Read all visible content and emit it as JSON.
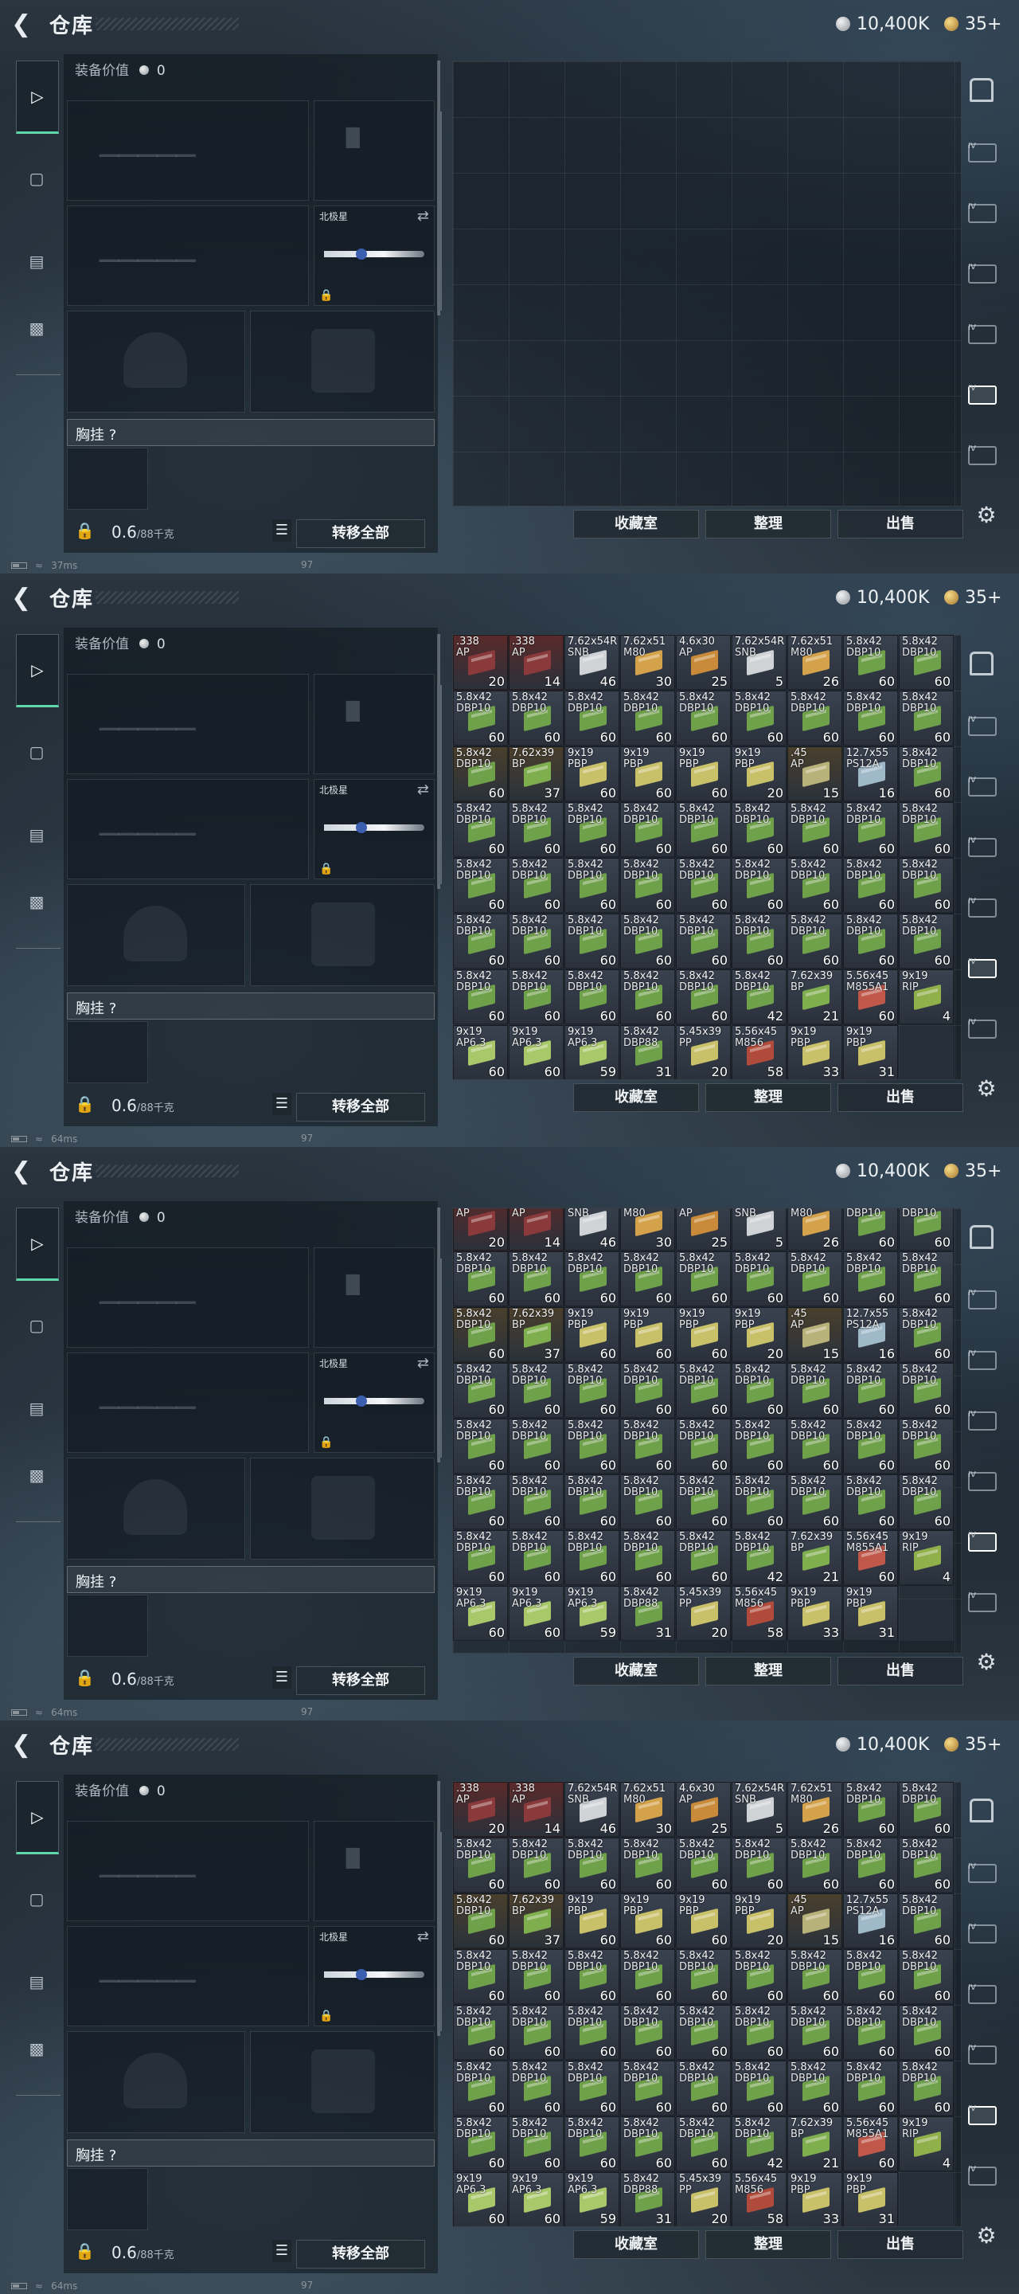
{
  "screens": [
    {
      "title": "仓库",
      "currency": {
        "silver": "10,400K",
        "gold": "35+"
      },
      "equip_value_label": "装备价值",
      "equip_value": "0",
      "knife_label": "北极星",
      "rig_label": "胸挂 ?",
      "weight": "0.6",
      "weight_max": "/88千克",
      "transfer_all": "转移全部",
      "buttons": {
        "collect": "收藏室",
        "sort": "整理",
        "sell": "出售"
      },
      "status": {
        "ping": "37ms",
        "fps": "97"
      },
      "grid_offset": 0,
      "has_items": false
    },
    {
      "title": "仓库",
      "currency": {
        "silver": "10,400K",
        "gold": "35+"
      },
      "equip_value_label": "装备价值",
      "equip_value": "0",
      "knife_label": "北极星",
      "rig_label": "胸挂 ?",
      "weight": "0.6",
      "weight_max": "/88千克",
      "transfer_all": "转移全部",
      "buttons": {
        "collect": "收藏室",
        "sort": "整理",
        "sell": "出售"
      },
      "status": {
        "ping": "64ms",
        "fps": "97"
      },
      "grid_offset": 0,
      "has_items": true
    },
    {
      "title": "仓库",
      "currency": {
        "silver": "10,400K",
        "gold": "35+"
      },
      "equip_value_label": "装备价值",
      "equip_value": "0",
      "knife_label": "北极星",
      "rig_label": "胸挂 ?",
      "weight": "0.6",
      "weight_max": "/88千克",
      "transfer_all": "转移全部",
      "buttons": {
        "collect": "收藏室",
        "sort": "整理",
        "sell": "出售"
      },
      "status": {
        "ping": "64ms",
        "fps": "97"
      },
      "grid_offset": 1,
      "has_items": true
    },
    {
      "title": "仓库",
      "currency": {
        "silver": "10,400K",
        "gold": "35+"
      },
      "equip_value_label": "装备价值",
      "equip_value": "0",
      "knife_label": "北极星",
      "rig_label": "胸挂 ?",
      "weight": "0.6",
      "weight_max": "/88千克",
      "transfer_all": "转移全部",
      "buttons": {
        "collect": "收藏室",
        "sort": "整理",
        "sell": "出售"
      },
      "status": {
        "ping": "64ms",
        "fps": "97"
      },
      "grid_offset": 0,
      "has_items": true
    }
  ],
  "stash_rows": [
    [
      {
        "n": ".338",
        "s": "AP",
        "q": "20",
        "c": "#8a3a3a"
      },
      {
        "n": ".338",
        "s": "AP",
        "q": "14",
        "c": "#8a3a3a"
      },
      {
        "n": "7.62x54R",
        "s": "SNB",
        "q": "46",
        "c": "#cfd3d6"
      },
      {
        "n": "7.62x51",
        "s": "M80",
        "q": "30",
        "c": "#d4a24a"
      },
      {
        "n": "4.6x30",
        "s": "AP",
        "q": "25",
        "c": "#c98a3a"
      },
      {
        "n": "7.62x54R",
        "s": "SNB",
        "q": "5",
        "c": "#cfd3d6"
      },
      {
        "n": "7.62x51",
        "s": "M80",
        "q": "26",
        "c": "#d4a24a"
      },
      {
        "n": "5.8x42",
        "s": "DBP10",
        "q": "60",
        "c": "#6fa04a"
      },
      {
        "n": "5.8x42",
        "s": "DBP10",
        "q": "60",
        "c": "#6fa04a"
      }
    ],
    [
      {
        "n": "5.8x42",
        "s": "DBP10",
        "q": "60",
        "c": "#6fa04a"
      },
      {
        "n": "5.8x42",
        "s": "DBP10",
        "q": "60",
        "c": "#6fa04a"
      },
      {
        "n": "5.8x42",
        "s": "DBP10",
        "q": "60",
        "c": "#6fa04a"
      },
      {
        "n": "5.8x42",
        "s": "DBP10",
        "q": "60",
        "c": "#6fa04a"
      },
      {
        "n": "5.8x42",
        "s": "DBP10",
        "q": "60",
        "c": "#6fa04a"
      },
      {
        "n": "5.8x42",
        "s": "DBP10",
        "q": "60",
        "c": "#6fa04a"
      },
      {
        "n": "5.8x42",
        "s": "DBP10",
        "q": "60",
        "c": "#6fa04a"
      },
      {
        "n": "5.8x42",
        "s": "DBP10",
        "q": "60",
        "c": "#6fa04a"
      },
      {
        "n": "5.8x42",
        "s": "DBP10",
        "q": "60",
        "c": "#6fa04a"
      }
    ],
    [
      {
        "n": "5.8x42",
        "s": "DBP10",
        "q": "60",
        "c": "#6fa04a"
      },
      {
        "n": "7.62x39",
        "s": "BP",
        "q": "37",
        "c": "#7fae4e"
      },
      {
        "n": "9x19",
        "s": "PBP",
        "q": "60",
        "c": "#c9c06a"
      },
      {
        "n": "9x19",
        "s": "PBP",
        "q": "60",
        "c": "#c9c06a"
      },
      {
        "n": "9x19",
        "s": "PBP",
        "q": "60",
        "c": "#c9c06a"
      },
      {
        "n": "9x19",
        "s": "PBP",
        "q": "20",
        "c": "#c9c06a"
      },
      {
        "n": ".45",
        "s": "AP",
        "q": "15",
        "c": "#b7b27a"
      },
      {
        "n": "12.7x55",
        "s": "PS12A",
        "q": "16",
        "c": "#9fb9c9"
      },
      {
        "n": "5.8x42",
        "s": "DBP10",
        "q": "60",
        "c": "#6fa04a"
      }
    ],
    [
      {
        "n": "5.8x42",
        "s": "DBP10",
        "q": "60",
        "c": "#6fa04a"
      },
      {
        "n": "5.8x42",
        "s": "DBP10",
        "q": "60",
        "c": "#6fa04a"
      },
      {
        "n": "5.8x42",
        "s": "DBP10",
        "q": "60",
        "c": "#6fa04a"
      },
      {
        "n": "5.8x42",
        "s": "DBP10",
        "q": "60",
        "c": "#6fa04a"
      },
      {
        "n": "5.8x42",
        "s": "DBP10",
        "q": "60",
        "c": "#6fa04a"
      },
      {
        "n": "5.8x42",
        "s": "DBP10",
        "q": "60",
        "c": "#6fa04a"
      },
      {
        "n": "5.8x42",
        "s": "DBP10",
        "q": "60",
        "c": "#6fa04a"
      },
      {
        "n": "5.8x42",
        "s": "DBP10",
        "q": "60",
        "c": "#6fa04a"
      },
      {
        "n": "5.8x42",
        "s": "DBP10",
        "q": "60",
        "c": "#6fa04a"
      }
    ],
    [
      {
        "n": "5.8x42",
        "s": "DBP10",
        "q": "60",
        "c": "#6fa04a"
      },
      {
        "n": "5.8x42",
        "s": "DBP10",
        "q": "60",
        "c": "#6fa04a"
      },
      {
        "n": "5.8x42",
        "s": "DBP10",
        "q": "60",
        "c": "#6fa04a"
      },
      {
        "n": "5.8x42",
        "s": "DBP10",
        "q": "60",
        "c": "#6fa04a"
      },
      {
        "n": "5.8x42",
        "s": "DBP10",
        "q": "60",
        "c": "#6fa04a"
      },
      {
        "n": "5.8x42",
        "s": "DBP10",
        "q": "60",
        "c": "#6fa04a"
      },
      {
        "n": "5.8x42",
        "s": "DBP10",
        "q": "60",
        "c": "#6fa04a"
      },
      {
        "n": "5.8x42",
        "s": "DBP10",
        "q": "60",
        "c": "#6fa04a"
      },
      {
        "n": "5.8x42",
        "s": "DBP10",
        "q": "60",
        "c": "#6fa04a"
      }
    ],
    [
      {
        "n": "5.8x42",
        "s": "DBP10",
        "q": "60",
        "c": "#6fa04a"
      },
      {
        "n": "5.8x42",
        "s": "DBP10",
        "q": "60",
        "c": "#6fa04a"
      },
      {
        "n": "5.8x42",
        "s": "DBP10",
        "q": "60",
        "c": "#6fa04a"
      },
      {
        "n": "5.8x42",
        "s": "DBP10",
        "q": "60",
        "c": "#6fa04a"
      },
      {
        "n": "5.8x42",
        "s": "DBP10",
        "q": "60",
        "c": "#6fa04a"
      },
      {
        "n": "5.8x42",
        "s": "DBP10",
        "q": "60",
        "c": "#6fa04a"
      },
      {
        "n": "5.8x42",
        "s": "DBP10",
        "q": "60",
        "c": "#6fa04a"
      },
      {
        "n": "5.8x42",
        "s": "DBP10",
        "q": "60",
        "c": "#6fa04a"
      },
      {
        "n": "5.8x42",
        "s": "DBP10",
        "q": "60",
        "c": "#6fa04a"
      }
    ],
    [
      {
        "n": "5.8x42",
        "s": "DBP10",
        "q": "60",
        "c": "#6fa04a"
      },
      {
        "n": "5.8x42",
        "s": "DBP10",
        "q": "60",
        "c": "#6fa04a"
      },
      {
        "n": "5.8x42",
        "s": "DBP10",
        "q": "60",
        "c": "#6fa04a"
      },
      {
        "n": "5.8x42",
        "s": "DBP10",
        "q": "60",
        "c": "#6fa04a"
      },
      {
        "n": "5.8x42",
        "s": "DBP10",
        "q": "60",
        "c": "#6fa04a"
      },
      {
        "n": "5.8x42",
        "s": "DBP10",
        "q": "42",
        "c": "#6fa04a"
      },
      {
        "n": "7.62x39",
        "s": "BP",
        "q": "21",
        "c": "#7fae4e"
      },
      {
        "n": "5.56x45",
        "s": "M855A1",
        "q": "60",
        "c": "#c0584a"
      },
      {
        "n": "9x19",
        "s": "RIP",
        "q": "4",
        "c": "#8fb04a"
      }
    ],
    [
      {
        "n": "9x19",
        "s": "AP6.3",
        "q": "60",
        "c": "#a9c86a"
      },
      {
        "n": "9x19",
        "s": "AP6.3",
        "q": "60",
        "c": "#a9c86a"
      },
      {
        "n": "9x19",
        "s": "AP6.3",
        "q": "59",
        "c": "#a9c86a"
      },
      {
        "n": "5.8x42",
        "s": "DBP88",
        "q": "31",
        "c": "#6fa04a"
      },
      {
        "n": "5.45x39",
        "s": "PP",
        "q": "20",
        "c": "#c9c06a"
      },
      {
        "n": "5.56x45",
        "s": "M856",
        "q": "58",
        "c": "#b04a3a"
      },
      {
        "n": "9x19",
        "s": "PBP",
        "q": "33",
        "c": "#c9c06a"
      },
      {
        "n": "9x19",
        "s": "PBP",
        "q": "31",
        "c": "#c9c06a"
      }
    ]
  ]
}
